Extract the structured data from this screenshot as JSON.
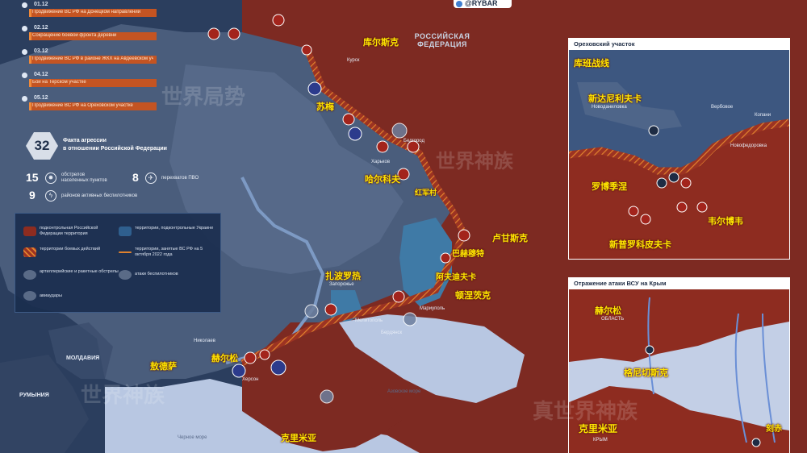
{
  "channel_tag": "@RYBAR",
  "events": [
    {
      "date": "01.12",
      "text": "Продвижение ВС РФ на Донецком направлении"
    },
    {
      "date": "02.12",
      "text": "Сокращение боевой фронта деревни"
    },
    {
      "date": "03.12",
      "text": "Продвижение ВС РФ в районе ЖКХ на Авдеевском участке"
    },
    {
      "date": "04.12",
      "text": "Бои на Терском участке"
    },
    {
      "date": "05.12",
      "text": "Продвижение ВС РФ на Ореховском участке"
    }
  ],
  "stats": {
    "total": "32",
    "total_label_1": "Факта агрессии",
    "total_label_2": "в отношении Российской Федерации",
    "shelled_count": "15",
    "shelled_label": "обстрелов населенных пунктов",
    "pvo_count": "8",
    "pvo_label": "перехватов ПВО",
    "drones_count": "9",
    "drones_label": "районов активных беспилотников"
  },
  "legend": {
    "ru_control": "подконтрольная Российской Федерации территория",
    "ua_control": "территории, подконтрольные Украине",
    "grey_zone": "территории боевых действий",
    "ru_line": "территории, занятые ВС РФ на 5 октября 2022 года",
    "artillery": "артиллерийские и ракетные обстрелы",
    "drone": "атаки беспилотников",
    "aviation": "авиаудары"
  },
  "map_labels_zh": {
    "kursk": "库尔斯克",
    "sumy": "苏梅",
    "belgorod": "哈尔科夫",
    "krasnyi_liman": "红军村",
    "lugansk": "卢甘斯克",
    "bakhmut": "巴赫穆特",
    "avdiivka": "阿夫迪夫卡",
    "donetsk": "顿涅茨克",
    "zaporozhye": "扎波罗热",
    "odessa": "敖德萨",
    "kherson": "赫尔松",
    "crimea": "克里米亚"
  },
  "map_labels_ru": {
    "russia": "РОССИЙСКАЯ ФЕДЕРАЦИЯ",
    "moldova": "МОЛДАВИЯ",
    "romania": "РУМЫНИЯ",
    "azov_sea": "Азовское море",
    "black_sea": "Черное море",
    "kursk": "Курск",
    "belgorod": "Белгород",
    "kharkov": "Харьков",
    "zaporozhye": "Запорожье",
    "kherson": "Херсон",
    "berdyansk": "Бердянск",
    "melitopol": "Мелитополь",
    "mariupol": "Мариуполь",
    "nikolaev": "Николаев"
  },
  "inset_orekhov": {
    "title": "Ореховский участок",
    "title_zh": "库班战线",
    "label_novodanilovka_zh": "新达尼利夫卡",
    "label_novodanilovka_ru": "Новоданиловка",
    "label_rabotino_zh": "罗博季涅",
    "label_verbovoe_zh": "韦尔博韦",
    "label_novoprokopovka_zh": "新普罗科皮夫卡",
    "label_verbovoe_ru": "Вербовое",
    "label_kopani_ru": "Копани",
    "label_novofedorovka_ru": "Новофедоровка"
  },
  "inset_crimea": {
    "title": "Отражение атаки ВСУ на Крым",
    "label_kherson_zh": "赫尔松",
    "label_kherson_ru": "ОБЛАСТЬ",
    "label_henichesk_zh": "格尼切斯克",
    "label_crimea_zh": "克里米亚",
    "label_kerch_zh": "刻赤",
    "label_crimea_ru": "КРЫМ"
  },
  "watermarks": [
    "世界局势",
    "世界神族",
    "真世界神族"
  ]
}
